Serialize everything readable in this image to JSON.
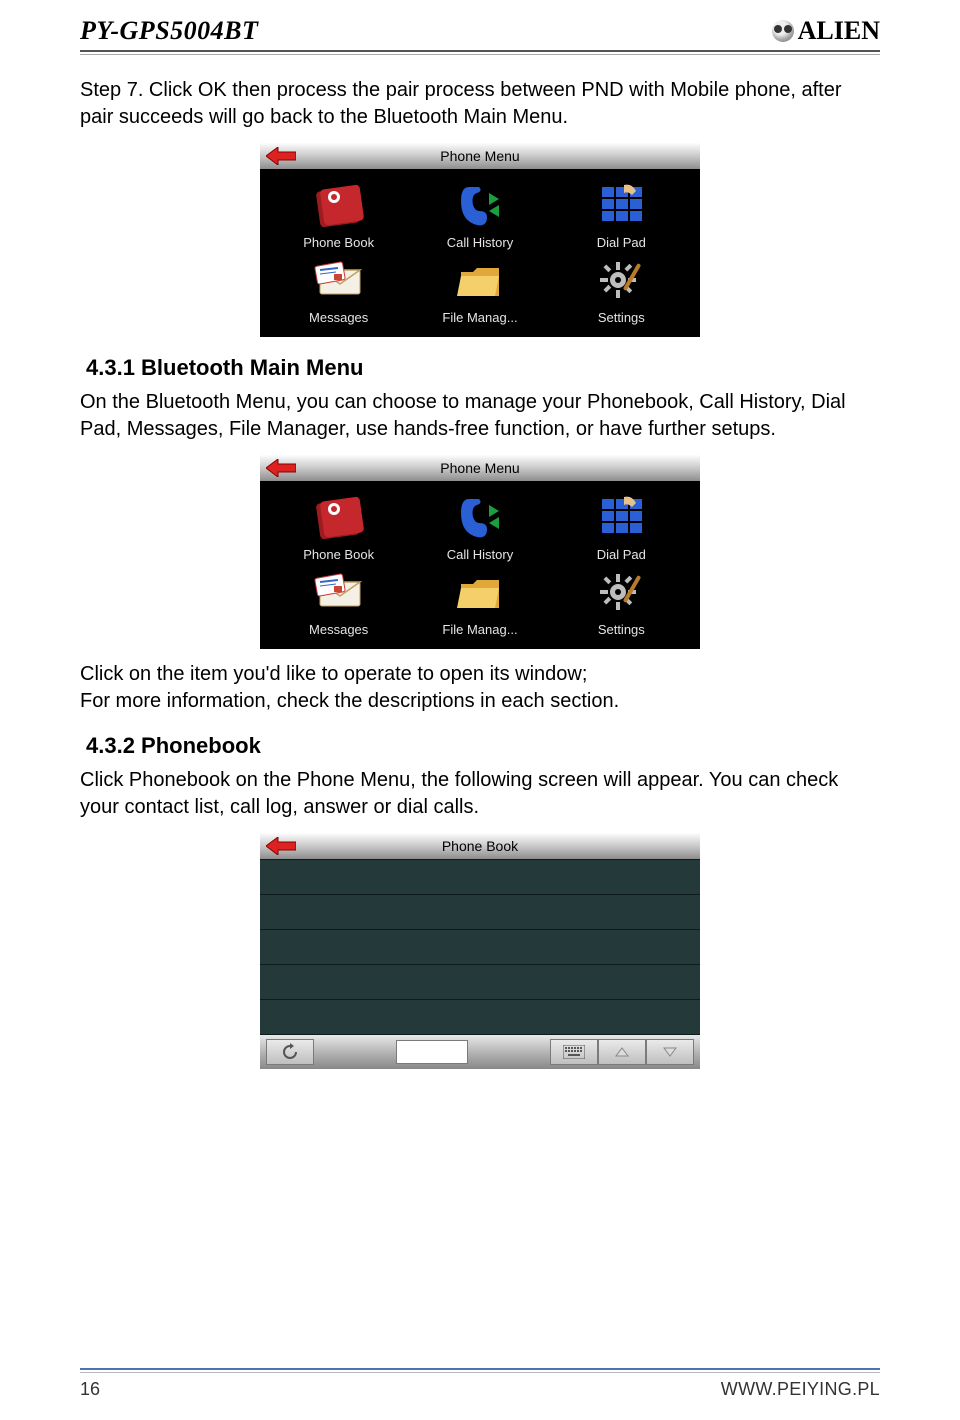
{
  "header": {
    "model": "PY-GPS5004BT",
    "brand": "ALIEN"
  },
  "step7_text": "Step 7. Click OK then process the pair process between PND with Mobile phone, after pair succeeds will go back to the Bluetooth Main Menu.",
  "phone_menu": {
    "title": "Phone Menu",
    "items": [
      "Phone Book",
      "Call History",
      "Dial Pad",
      "Messages",
      "File Manag...",
      "Settings"
    ]
  },
  "section_431_heading": "4.3.1 Bluetooth Main Menu",
  "section_431_text": "On the Bluetooth Menu, you can choose to manage your Phonebook, Call History, Dial Pad, Messages, File Manager,  use hands-free function, or have further setups.",
  "click_item_text_l1": "Click on the item you'd like to operate to open its window;",
  "click_item_text_l2": "For more information, check the descriptions in each section.",
  "section_432_heading": "4.3.2 Phonebook",
  "section_432_text": "Click Phonebook on the Phone Menu, the following screen will appear.  You can check your contact list, call log, answer or dial calls.",
  "phonebook": {
    "title": "Phone Book"
  },
  "footer": {
    "page": "16",
    "url": "WWW.PEIYING.PL"
  }
}
